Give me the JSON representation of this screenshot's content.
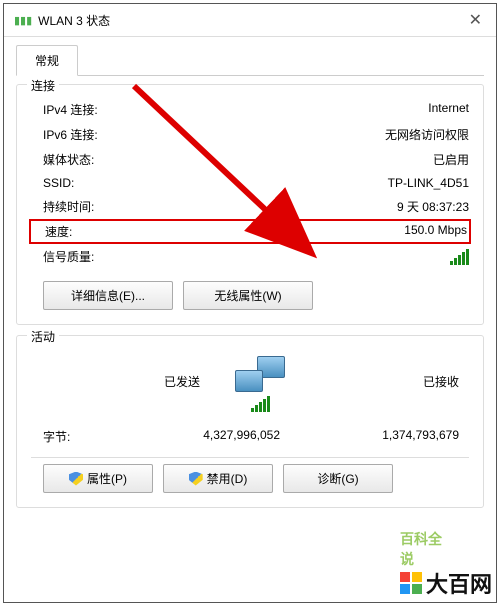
{
  "window": {
    "title": "WLAN 3 状态"
  },
  "tab": {
    "general": "常规"
  },
  "connection": {
    "title": "连接",
    "rows": {
      "ipv4": {
        "label": "IPv4 连接:",
        "value": "Internet"
      },
      "ipv6": {
        "label": "IPv6 连接:",
        "value": "无网络访问权限"
      },
      "media": {
        "label": "媒体状态:",
        "value": "已启用"
      },
      "ssid": {
        "label": "SSID:",
        "value": "TP-LINK_4D51"
      },
      "duration": {
        "label": "持续时间:",
        "value": "9 天 08:37:23"
      },
      "speed": {
        "label": "速度:",
        "value": "150.0 Mbps"
      },
      "signal": {
        "label": "信号质量:"
      }
    },
    "buttons": {
      "details": "详细信息(E)...",
      "wireless": "无线属性(W)"
    }
  },
  "activity": {
    "title": "活动",
    "sent": "已发送",
    "received": "已接收",
    "bytes_label": "字节:",
    "bytes_sent": "4,327,996,052",
    "bytes_received": "1,374,793,679",
    "buttons": {
      "properties": "属性(P)",
      "disable": "禁用(D)",
      "diagnose": "诊断(G)"
    }
  },
  "watermark": {
    "hint": "百科全说",
    "brand": "大百网"
  }
}
